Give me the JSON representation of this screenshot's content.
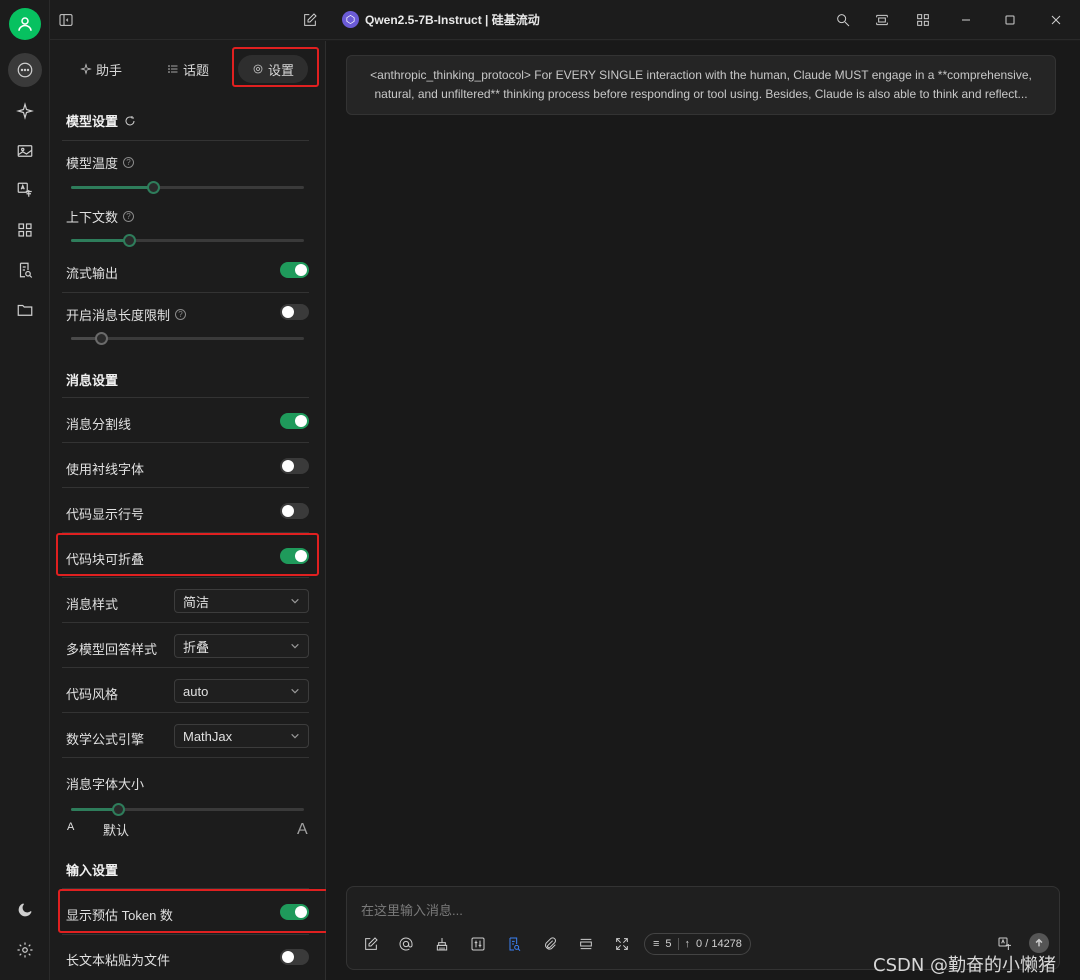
{
  "window": {
    "model_title": "Qwen2.5-7B-Instruct | 硅基流动"
  },
  "tabs": {
    "assistant": "助手",
    "topics": "话题",
    "settings": "设置"
  },
  "model_settings": {
    "title": "模型设置",
    "temperature_label": "模型温度",
    "temperature_value": 0.35,
    "context_label": "上下文数",
    "context_value": 0.25,
    "stream_label": "流式输出",
    "stream_on": true,
    "max_length_label": "开启消息长度限制",
    "max_length_on": false,
    "max_length_value": 0.13
  },
  "message_settings": {
    "title": "消息设置",
    "divider_label": "消息分割线",
    "divider_on": true,
    "serif_label": "使用衬线字体",
    "serif_on": false,
    "line_numbers_label": "代码显示行号",
    "line_numbers_on": false,
    "collapsible_label": "代码块可折叠",
    "collapsible_on": true,
    "style_label": "消息样式",
    "style_value": "简洁",
    "multi_model_label": "多模型回答样式",
    "multi_model_value": "折叠",
    "code_style_label": "代码风格",
    "code_style_value": "auto",
    "math_label": "数学公式引擎",
    "math_value": "MathJax",
    "font_size_label": "消息字体大小",
    "font_size_small": "A",
    "font_size_default": "默认",
    "font_size_large": "A",
    "font_size_value": 0.2
  },
  "input_settings": {
    "title": "输入设置",
    "token_label": "显示预估 Token 数",
    "token_on": true,
    "paste_label": "长文本粘贴为文件",
    "paste_on": false
  },
  "main": {
    "system_prompt": "<anthropic_thinking_protocol> For EVERY SINGLE interaction with the human, Claude MUST engage in a **comprehensive, natural, and unfiltered** thinking process before responding or tool using. Besides, Claude is also able to think and reflect...",
    "input_placeholder": "在这里输入消息...",
    "context_count": "5",
    "token_count": "0 / 14278"
  },
  "watermark": "CSDN @勤奋的小懒猪"
}
